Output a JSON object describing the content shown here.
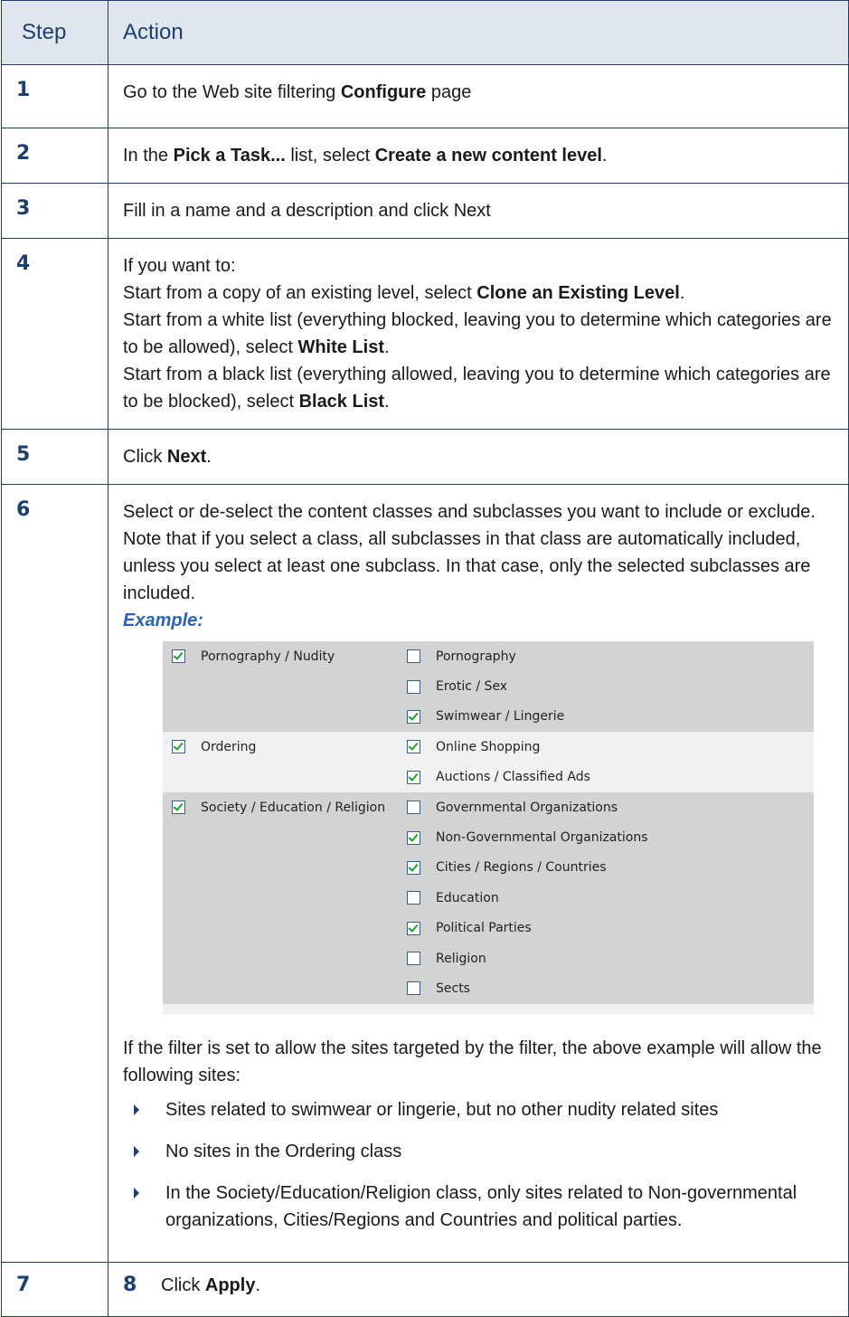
{
  "header": {
    "step": "Step",
    "action": "Action"
  },
  "steps": [
    {
      "n": "1",
      "parts": [
        "Go to the Web site filtering ",
        "Configure",
        " page"
      ]
    },
    {
      "n": "2",
      "parts": [
        "In the ",
        "Pick a Task...",
        " list, select ",
        "Create a new content level",
        "."
      ]
    },
    {
      "n": "3",
      "text": "Fill in a name and a description and click Next"
    },
    {
      "n": "4",
      "intro": "If you want to:",
      "l1": [
        "Start from a copy of an existing level, select ",
        "Clone an Existing Level",
        "."
      ],
      "l2": [
        "Start from a white list (everything blocked, leaving you to determine which categories are to be allowed), select ",
        "White List",
        "."
      ],
      "l3": [
        "Start from a black list (everything allowed, leaving you to determine which categories are to be blocked), select ",
        "Black List",
        "."
      ]
    },
    {
      "n": "5",
      "parts": [
        "Click ",
        "Next",
        "."
      ]
    },
    {
      "n": "6",
      "p1": "Select or de-select the content classes and subclasses you want to include or exclude.",
      "p2": "Note that if you select a class, all subclasses in that class are automatically included, unless you select at least one subclass. In that case, only the selected subclasses are included.",
      "example_label": "Example:",
      "after": "If the filter is set to allow the sites targeted by the filter, the above example will allow the following sites:",
      "bullets": [
        "Sites related to swimwear or lingerie, but no other nudity related sites",
        "No sites in the Ordering class",
        "In the Society/Education/Religion class, only sites related to Non-governmental organizations, Cities/Regions and Countries and political parties."
      ]
    },
    {
      "n": "7",
      "inner_n": "8",
      "parts": [
        "Click ",
        "Apply",
        "."
      ]
    }
  ],
  "example": {
    "groups": [
      {
        "class": "Pornography / Nudity",
        "checked": true,
        "subs": [
          {
            "label": "Pornography",
            "checked": false
          },
          {
            "label": "Erotic / Sex",
            "checked": false
          },
          {
            "label": "Swimwear / Lingerie",
            "checked": true
          }
        ]
      },
      {
        "class": "Ordering",
        "checked": true,
        "subs": [
          {
            "label": "Online Shopping",
            "checked": true
          },
          {
            "label": "Auctions / Classified Ads",
            "checked": true
          }
        ]
      },
      {
        "class": "Society / Education / Religion",
        "checked": true,
        "subs": [
          {
            "label": "Governmental Organizations",
            "checked": false
          },
          {
            "label": "Non-Governmental Organizations",
            "checked": true
          },
          {
            "label": "Cities / Regions / Countries",
            "checked": true
          },
          {
            "label": "Education",
            "checked": false
          },
          {
            "label": "Political Parties",
            "checked": true
          },
          {
            "label": "Religion",
            "checked": false
          },
          {
            "label": "Sects",
            "checked": false
          }
        ]
      }
    ]
  }
}
